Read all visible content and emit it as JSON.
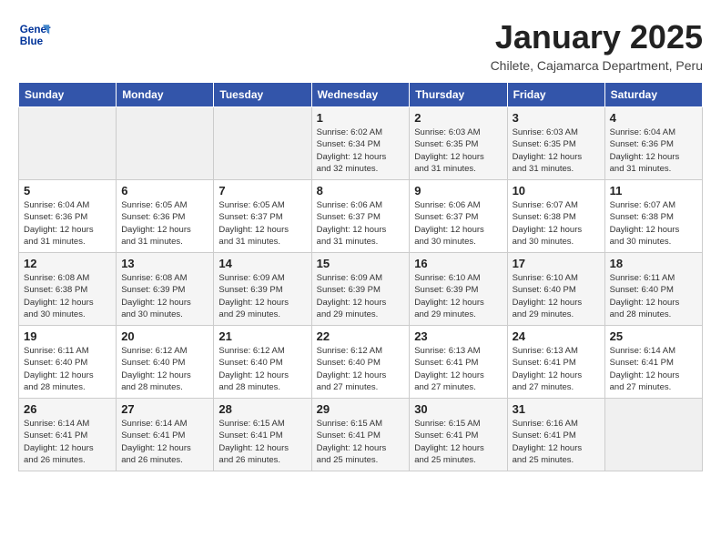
{
  "header": {
    "logo_line1": "General",
    "logo_line2": "Blue",
    "month": "January 2025",
    "location": "Chilete, Cajamarca Department, Peru"
  },
  "weekdays": [
    "Sunday",
    "Monday",
    "Tuesday",
    "Wednesday",
    "Thursday",
    "Friday",
    "Saturday"
  ],
  "weeks": [
    [
      {
        "day": "",
        "info": ""
      },
      {
        "day": "",
        "info": ""
      },
      {
        "day": "",
        "info": ""
      },
      {
        "day": "1",
        "info": "Sunrise: 6:02 AM\nSunset: 6:34 PM\nDaylight: 12 hours\nand 32 minutes."
      },
      {
        "day": "2",
        "info": "Sunrise: 6:03 AM\nSunset: 6:35 PM\nDaylight: 12 hours\nand 31 minutes."
      },
      {
        "day": "3",
        "info": "Sunrise: 6:03 AM\nSunset: 6:35 PM\nDaylight: 12 hours\nand 31 minutes."
      },
      {
        "day": "4",
        "info": "Sunrise: 6:04 AM\nSunset: 6:36 PM\nDaylight: 12 hours\nand 31 minutes."
      }
    ],
    [
      {
        "day": "5",
        "info": "Sunrise: 6:04 AM\nSunset: 6:36 PM\nDaylight: 12 hours\nand 31 minutes."
      },
      {
        "day": "6",
        "info": "Sunrise: 6:05 AM\nSunset: 6:36 PM\nDaylight: 12 hours\nand 31 minutes."
      },
      {
        "day": "7",
        "info": "Sunrise: 6:05 AM\nSunset: 6:37 PM\nDaylight: 12 hours\nand 31 minutes."
      },
      {
        "day": "8",
        "info": "Sunrise: 6:06 AM\nSunset: 6:37 PM\nDaylight: 12 hours\nand 31 minutes."
      },
      {
        "day": "9",
        "info": "Sunrise: 6:06 AM\nSunset: 6:37 PM\nDaylight: 12 hours\nand 30 minutes."
      },
      {
        "day": "10",
        "info": "Sunrise: 6:07 AM\nSunset: 6:38 PM\nDaylight: 12 hours\nand 30 minutes."
      },
      {
        "day": "11",
        "info": "Sunrise: 6:07 AM\nSunset: 6:38 PM\nDaylight: 12 hours\nand 30 minutes."
      }
    ],
    [
      {
        "day": "12",
        "info": "Sunrise: 6:08 AM\nSunset: 6:38 PM\nDaylight: 12 hours\nand 30 minutes."
      },
      {
        "day": "13",
        "info": "Sunrise: 6:08 AM\nSunset: 6:39 PM\nDaylight: 12 hours\nand 30 minutes."
      },
      {
        "day": "14",
        "info": "Sunrise: 6:09 AM\nSunset: 6:39 PM\nDaylight: 12 hours\nand 29 minutes."
      },
      {
        "day": "15",
        "info": "Sunrise: 6:09 AM\nSunset: 6:39 PM\nDaylight: 12 hours\nand 29 minutes."
      },
      {
        "day": "16",
        "info": "Sunrise: 6:10 AM\nSunset: 6:39 PM\nDaylight: 12 hours\nand 29 minutes."
      },
      {
        "day": "17",
        "info": "Sunrise: 6:10 AM\nSunset: 6:40 PM\nDaylight: 12 hours\nand 29 minutes."
      },
      {
        "day": "18",
        "info": "Sunrise: 6:11 AM\nSunset: 6:40 PM\nDaylight: 12 hours\nand 28 minutes."
      }
    ],
    [
      {
        "day": "19",
        "info": "Sunrise: 6:11 AM\nSunset: 6:40 PM\nDaylight: 12 hours\nand 28 minutes."
      },
      {
        "day": "20",
        "info": "Sunrise: 6:12 AM\nSunset: 6:40 PM\nDaylight: 12 hours\nand 28 minutes."
      },
      {
        "day": "21",
        "info": "Sunrise: 6:12 AM\nSunset: 6:40 PM\nDaylight: 12 hours\nand 28 minutes."
      },
      {
        "day": "22",
        "info": "Sunrise: 6:12 AM\nSunset: 6:40 PM\nDaylight: 12 hours\nand 27 minutes."
      },
      {
        "day": "23",
        "info": "Sunrise: 6:13 AM\nSunset: 6:41 PM\nDaylight: 12 hours\nand 27 minutes."
      },
      {
        "day": "24",
        "info": "Sunrise: 6:13 AM\nSunset: 6:41 PM\nDaylight: 12 hours\nand 27 minutes."
      },
      {
        "day": "25",
        "info": "Sunrise: 6:14 AM\nSunset: 6:41 PM\nDaylight: 12 hours\nand 27 minutes."
      }
    ],
    [
      {
        "day": "26",
        "info": "Sunrise: 6:14 AM\nSunset: 6:41 PM\nDaylight: 12 hours\nand 26 minutes."
      },
      {
        "day": "27",
        "info": "Sunrise: 6:14 AM\nSunset: 6:41 PM\nDaylight: 12 hours\nand 26 minutes."
      },
      {
        "day": "28",
        "info": "Sunrise: 6:15 AM\nSunset: 6:41 PM\nDaylight: 12 hours\nand 26 minutes."
      },
      {
        "day": "29",
        "info": "Sunrise: 6:15 AM\nSunset: 6:41 PM\nDaylight: 12 hours\nand 25 minutes."
      },
      {
        "day": "30",
        "info": "Sunrise: 6:15 AM\nSunset: 6:41 PM\nDaylight: 12 hours\nand 25 minutes."
      },
      {
        "day": "31",
        "info": "Sunrise: 6:16 AM\nSunset: 6:41 PM\nDaylight: 12 hours\nand 25 minutes."
      },
      {
        "day": "",
        "info": ""
      }
    ]
  ]
}
